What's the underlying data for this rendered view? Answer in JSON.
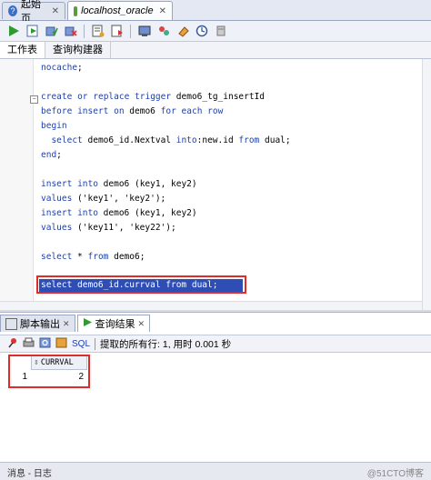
{
  "tabs": [
    {
      "label": "起始页",
      "icon": "help-icon",
      "active": false
    },
    {
      "label": "localhost_oracle",
      "icon": "database-icon",
      "active": true
    }
  ],
  "worksheet_tabs": [
    "工作表",
    "查询构建器"
  ],
  "editor_lines": [
    {
      "text": "nocache;"
    },
    {
      "text": ""
    },
    {
      "text": "create or replace trigger demo6_tg_insertId"
    },
    {
      "text": "before insert on demo6 for each row"
    },
    {
      "text": "begin"
    },
    {
      "text": "  select demo6_id.Nextval into:new.id from dual;"
    },
    {
      "text": "end;"
    },
    {
      "text": ""
    },
    {
      "text": "insert into demo6 (key1, key2)"
    },
    {
      "text": "values ('key1', 'key2');"
    },
    {
      "text": "insert into demo6 (key1, key2)"
    },
    {
      "text": "values ('key11', 'key22');"
    },
    {
      "text": ""
    },
    {
      "text": "select * from demo6;"
    }
  ],
  "selected_statement": "select demo6_id.currval from dual;",
  "bottom_tabs": [
    "脚本输出",
    "查询结果"
  ],
  "results_toolbar": {
    "sql_label": "SQL",
    "status_text": "提取的所有行: 1, 用时 0.001 秒"
  },
  "result_grid": {
    "column": "CURRVAL",
    "rows": [
      {
        "row_num": "1",
        "value": "2"
      }
    ]
  },
  "statusbar": {
    "left": "消息 - 日志",
    "watermark": "@51CTO博客"
  }
}
